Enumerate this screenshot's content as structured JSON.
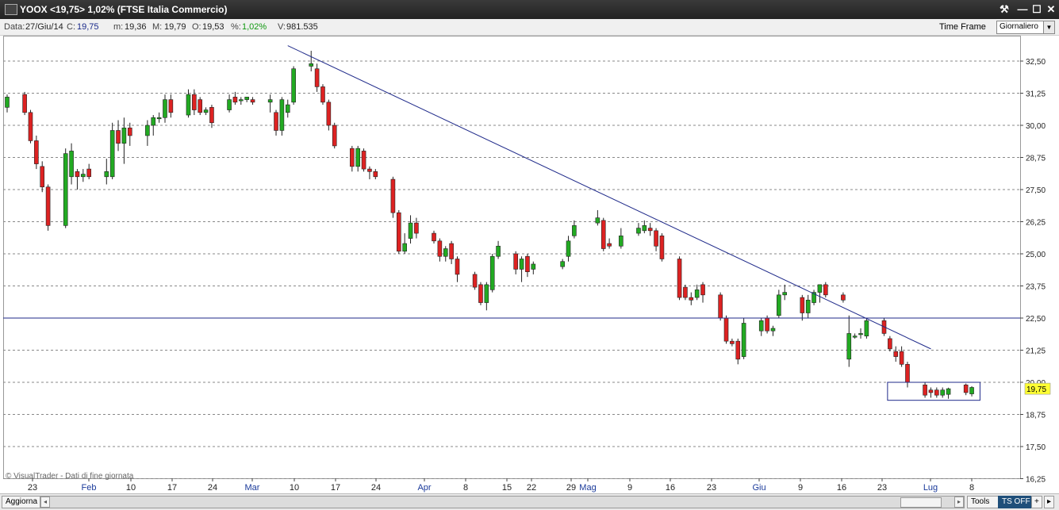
{
  "window": {
    "title": "YOOX <19,75> 1,02%  (FTSE Italia Commercio)",
    "controls": [
      "⚒",
      "—",
      "☐",
      "✕"
    ]
  },
  "infobar": {
    "data_label": "Data:",
    "data_value": "27/Giu/14",
    "c_label": "C:",
    "c_value": "19,75",
    "m_label": "m:",
    "m_value": "19,36",
    "M_label": "M:",
    "M_value": "19,79",
    "o_label": "O:",
    "o_value": "19,53",
    "pct_label": "%:",
    "pct_value": "1,02%",
    "v_label": "V:",
    "v_value": "981.535",
    "timeframe_label": "Time Frame",
    "timeframe_value": "Giornaliero"
  },
  "watermark": "© VisualTrader - Dati di fine giornata",
  "current_price_label": "19,75",
  "bottombar": {
    "refresh_label": "Aggiorna",
    "tools_label": "Tools",
    "tsoff_label": "TS OFF",
    "plus_label": "+",
    "arrow_label": "▸"
  },
  "colors": {
    "up": "#22aa22",
    "down": "#dd2222",
    "trendline": "#1f2a8a",
    "price_tag": "#ffff33",
    "grid": "#888888"
  },
  "chart_data": {
    "type": "candlestick",
    "ylim": [
      16.25,
      33.4
    ],
    "y_ticks": [
      "32,50",
      "31,25",
      "30,00",
      "28,75",
      "27,50",
      "26,25",
      "25,00",
      "23,75",
      "22,50",
      "21,25",
      "20,00",
      "18,75",
      "17,50",
      "16,25"
    ],
    "x_ticks": [
      "23",
      "Feb",
      "10",
      "17",
      "24",
      "Mar",
      "10",
      "17",
      "24",
      "Apr",
      "8",
      "15",
      "22",
      "29",
      "Mag",
      "9",
      "16",
      "23",
      "Giu",
      "9",
      "16",
      "23",
      "Lug",
      "8"
    ],
    "horizontal_line_value": 22.5,
    "trendline": {
      "from": [
        "2014-03-06",
        33.1
      ],
      "to": [
        "2014-06-24",
        21.3
      ]
    },
    "consolidation_box": {
      "from": "2014-06-17",
      "to": "2014-07-02",
      "high": 20.0,
      "low": 19.3
    },
    "candles": [
      {
        "date": "2014-01-17",
        "o": 30.7,
        "h": 31.2,
        "l": 30.5,
        "c": 31.1
      },
      {
        "date": "2014-01-20",
        "o": 31.2,
        "h": 31.3,
        "l": 30.4,
        "c": 30.5
      },
      {
        "date": "2014-01-21",
        "o": 30.5,
        "h": 30.6,
        "l": 29.3,
        "c": 29.4
      },
      {
        "date": "2014-01-22",
        "o": 29.4,
        "h": 29.6,
        "l": 28.3,
        "c": 28.5
      },
      {
        "date": "2014-01-23",
        "o": 28.4,
        "h": 28.6,
        "l": 27.4,
        "c": 27.6
      },
      {
        "date": "2014-01-24",
        "o": 27.6,
        "h": 27.7,
        "l": 25.9,
        "c": 26.1
      },
      {
        "date": "2014-01-27",
        "o": 26.1,
        "h": 29.1,
        "l": 26.0,
        "c": 28.9
      },
      {
        "date": "2014-01-28",
        "o": 28.0,
        "h": 29.3,
        "l": 27.7,
        "c": 29.0
      },
      {
        "date": "2014-01-29",
        "o": 28.2,
        "h": 28.3,
        "l": 27.5,
        "c": 28.0
      },
      {
        "date": "2014-01-30",
        "o": 28.0,
        "h": 28.3,
        "l": 27.8,
        "c": 28.1
      },
      {
        "date": "2014-01-31",
        "o": 28.3,
        "h": 28.5,
        "l": 27.9,
        "c": 28.0
      },
      {
        "date": "2014-02-03",
        "o": 28.0,
        "h": 28.7,
        "l": 27.7,
        "c": 28.2
      },
      {
        "date": "2014-02-04",
        "o": 28.0,
        "h": 30.1,
        "l": 27.9,
        "c": 29.8
      },
      {
        "date": "2014-02-05",
        "o": 29.8,
        "h": 30.2,
        "l": 29.0,
        "c": 29.3
      },
      {
        "date": "2014-02-06",
        "o": 29.3,
        "h": 30.3,
        "l": 28.5,
        "c": 29.9
      },
      {
        "date": "2014-02-07",
        "o": 29.9,
        "h": 30.1,
        "l": 29.2,
        "c": 29.6
      },
      {
        "date": "2014-02-10",
        "o": 29.6,
        "h": 30.2,
        "l": 29.2,
        "c": 30.0
      },
      {
        "date": "2014-02-11",
        "o": 30.0,
        "h": 30.4,
        "l": 29.6,
        "c": 30.3
      },
      {
        "date": "2014-02-12",
        "o": 30.3,
        "h": 30.5,
        "l": 30.1,
        "c": 30.3
      },
      {
        "date": "2014-02-13",
        "o": 30.3,
        "h": 31.2,
        "l": 30.1,
        "c": 31.0
      },
      {
        "date": "2014-02-14",
        "o": 31.0,
        "h": 31.2,
        "l": 30.3,
        "c": 30.5
      },
      {
        "date": "2014-02-17",
        "o": 30.4,
        "h": 31.4,
        "l": 30.3,
        "c": 31.2
      },
      {
        "date": "2014-02-18",
        "o": 31.2,
        "h": 31.4,
        "l": 30.4,
        "c": 30.6
      },
      {
        "date": "2014-02-19",
        "o": 31.0,
        "h": 31.1,
        "l": 30.4,
        "c": 30.5
      },
      {
        "date": "2014-02-20",
        "o": 30.5,
        "h": 30.7,
        "l": 30.4,
        "c": 30.6
      },
      {
        "date": "2014-02-21",
        "o": 30.7,
        "h": 30.8,
        "l": 29.9,
        "c": 30.1
      },
      {
        "date": "2014-02-24",
        "o": 30.6,
        "h": 31.2,
        "l": 30.5,
        "c": 31.0
      },
      {
        "date": "2014-02-25",
        "o": 31.1,
        "h": 31.3,
        "l": 30.8,
        "c": 30.9
      },
      {
        "date": "2014-02-26",
        "o": 31.0,
        "h": 31.1,
        "l": 30.8,
        "c": 31.0
      },
      {
        "date": "2014-02-27",
        "o": 31.0,
        "h": 31.1,
        "l": 30.9,
        "c": 31.1
      },
      {
        "date": "2014-02-28",
        "o": 31.0,
        "h": 31.1,
        "l": 30.8,
        "c": 30.9
      },
      {
        "date": "2014-03-03",
        "o": 30.9,
        "h": 31.2,
        "l": 30.5,
        "c": 31.0
      },
      {
        "date": "2014-03-04",
        "o": 30.5,
        "h": 30.6,
        "l": 29.6,
        "c": 29.8
      },
      {
        "date": "2014-03-05",
        "o": 29.8,
        "h": 31.1,
        "l": 29.6,
        "c": 31.0
      },
      {
        "date": "2014-03-06",
        "o": 30.5,
        "h": 31.0,
        "l": 30.3,
        "c": 30.8
      },
      {
        "date": "2014-03-07",
        "o": 30.9,
        "h": 32.3,
        "l": 30.8,
        "c": 32.2
      },
      {
        "date": "2014-03-10",
        "o": 32.3,
        "h": 32.9,
        "l": 32.1,
        "c": 32.4
      },
      {
        "date": "2014-03-11",
        "o": 32.2,
        "h": 32.4,
        "l": 31.3,
        "c": 31.5
      },
      {
        "date": "2014-03-12",
        "o": 31.5,
        "h": 31.6,
        "l": 30.8,
        "c": 30.9
      },
      {
        "date": "2014-03-13",
        "o": 30.9,
        "h": 31.0,
        "l": 29.8,
        "c": 30.0
      },
      {
        "date": "2014-03-14",
        "o": 30.0,
        "h": 30.1,
        "l": 29.1,
        "c": 29.2
      },
      {
        "date": "2014-03-17",
        "o": 29.1,
        "h": 29.2,
        "l": 28.2,
        "c": 28.4
      },
      {
        "date": "2014-03-18",
        "o": 28.4,
        "h": 29.2,
        "l": 28.2,
        "c": 29.1
      },
      {
        "date": "2014-03-19",
        "o": 29.0,
        "h": 29.1,
        "l": 28.2,
        "c": 28.3
      },
      {
        "date": "2014-03-20",
        "o": 28.3,
        "h": 28.4,
        "l": 27.9,
        "c": 28.2
      },
      {
        "date": "2014-03-21",
        "o": 28.2,
        "h": 28.3,
        "l": 27.9,
        "c": 28.0
      },
      {
        "date": "2014-03-24",
        "o": 27.9,
        "h": 28.0,
        "l": 26.4,
        "c": 26.6
      },
      {
        "date": "2014-03-25",
        "o": 26.6,
        "h": 26.7,
        "l": 25.0,
        "c": 25.1
      },
      {
        "date": "2014-03-26",
        "o": 25.1,
        "h": 25.8,
        "l": 25.0,
        "c": 25.4
      },
      {
        "date": "2014-03-27",
        "o": 25.6,
        "h": 26.5,
        "l": 25.4,
        "c": 26.2
      },
      {
        "date": "2014-03-28",
        "o": 26.2,
        "h": 26.4,
        "l": 25.6,
        "c": 25.8
      },
      {
        "date": "2014-03-31",
        "o": 25.8,
        "h": 25.9,
        "l": 25.4,
        "c": 25.5
      },
      {
        "date": "2014-04-01",
        "o": 25.5,
        "h": 25.6,
        "l": 24.7,
        "c": 24.9
      },
      {
        "date": "2014-04-02",
        "o": 24.9,
        "h": 25.3,
        "l": 24.7,
        "c": 25.2
      },
      {
        "date": "2014-04-03",
        "o": 25.4,
        "h": 25.5,
        "l": 24.6,
        "c": 24.8
      },
      {
        "date": "2014-04-04",
        "o": 24.8,
        "h": 24.9,
        "l": 23.9,
        "c": 24.2
      },
      {
        "date": "2014-04-07",
        "o": 24.2,
        "h": 24.3,
        "l": 23.6,
        "c": 23.7
      },
      {
        "date": "2014-04-08",
        "o": 23.8,
        "h": 23.9,
        "l": 23.0,
        "c": 23.1
      },
      {
        "date": "2014-04-09",
        "o": 23.1,
        "h": 23.9,
        "l": 22.8,
        "c": 23.8
      },
      {
        "date": "2014-04-10",
        "o": 23.6,
        "h": 25.0,
        "l": 23.5,
        "c": 24.9
      },
      {
        "date": "2014-04-11",
        "o": 24.9,
        "h": 25.5,
        "l": 24.8,
        "c": 25.3
      },
      {
        "date": "2014-04-14",
        "o": 25.0,
        "h": 25.1,
        "l": 24.2,
        "c": 24.4
      },
      {
        "date": "2014-04-15",
        "o": 24.4,
        "h": 24.9,
        "l": 23.9,
        "c": 24.8
      },
      {
        "date": "2014-04-16",
        "o": 24.9,
        "h": 25.0,
        "l": 24.1,
        "c": 24.3
      },
      {
        "date": "2014-04-17",
        "o": 24.4,
        "h": 24.7,
        "l": 24.2,
        "c": 24.6
      },
      {
        "date": "2014-04-22",
        "o": 24.5,
        "h": 24.8,
        "l": 24.4,
        "c": 24.7
      },
      {
        "date": "2014-04-23",
        "o": 24.9,
        "h": 25.7,
        "l": 24.7,
        "c": 25.5
      },
      {
        "date": "2014-04-24",
        "o": 25.7,
        "h": 26.3,
        "l": 25.6,
        "c": 26.1
      },
      {
        "date": "2014-04-28",
        "o": 26.2,
        "h": 26.7,
        "l": 26.1,
        "c": 26.4
      },
      {
        "date": "2014-04-29",
        "o": 26.3,
        "h": 26.4,
        "l": 25.1,
        "c": 25.2
      },
      {
        "date": "2014-04-30",
        "o": 25.4,
        "h": 25.6,
        "l": 25.2,
        "c": 25.3
      },
      {
        "date": "2014-05-02",
        "o": 25.3,
        "h": 26.0,
        "l": 25.2,
        "c": 25.7
      },
      {
        "date": "2014-05-05",
        "o": 25.8,
        "h": 26.2,
        "l": 25.7,
        "c": 26.0
      },
      {
        "date": "2014-05-06",
        "o": 25.9,
        "h": 26.3,
        "l": 25.8,
        "c": 26.1
      },
      {
        "date": "2014-05-07",
        "o": 26.0,
        "h": 26.2,
        "l": 25.7,
        "c": 25.9
      },
      {
        "date": "2014-05-08",
        "o": 25.9,
        "h": 26.0,
        "l": 25.1,
        "c": 25.3
      },
      {
        "date": "2014-05-09",
        "o": 25.7,
        "h": 25.8,
        "l": 24.7,
        "c": 24.8
      },
      {
        "date": "2014-05-12",
        "o": 24.8,
        "h": 24.9,
        "l": 23.2,
        "c": 23.3
      },
      {
        "date": "2014-05-13",
        "o": 23.7,
        "h": 23.8,
        "l": 23.2,
        "c": 23.3
      },
      {
        "date": "2014-05-14",
        "o": 23.3,
        "h": 23.5,
        "l": 23.0,
        "c": 23.2
      },
      {
        "date": "2014-05-15",
        "o": 23.3,
        "h": 23.8,
        "l": 23.2,
        "c": 23.6
      },
      {
        "date": "2014-05-16",
        "o": 23.8,
        "h": 23.9,
        "l": 23.1,
        "c": 23.4
      },
      {
        "date": "2014-05-19",
        "o": 23.4,
        "h": 23.5,
        "l": 22.4,
        "c": 22.5
      },
      {
        "date": "2014-05-20",
        "o": 22.5,
        "h": 22.6,
        "l": 21.5,
        "c": 21.6
      },
      {
        "date": "2014-05-21",
        "o": 21.6,
        "h": 21.7,
        "l": 21.4,
        "c": 21.5
      },
      {
        "date": "2014-05-22",
        "o": 21.6,
        "h": 21.7,
        "l": 20.7,
        "c": 20.9
      },
      {
        "date": "2014-05-23",
        "o": 21.0,
        "h": 22.5,
        "l": 20.9,
        "c": 22.3
      },
      {
        "date": "2014-05-26",
        "o": 22.0,
        "h": 22.5,
        "l": 21.8,
        "c": 22.4
      },
      {
        "date": "2014-05-27",
        "o": 22.5,
        "h": 22.6,
        "l": 21.9,
        "c": 22.0
      },
      {
        "date": "2014-05-28",
        "o": 22.0,
        "h": 22.2,
        "l": 21.8,
        "c": 22.1
      },
      {
        "date": "2014-05-29",
        "o": 22.6,
        "h": 23.6,
        "l": 22.5,
        "c": 23.4
      },
      {
        "date": "2014-05-30",
        "o": 23.4,
        "h": 23.8,
        "l": 23.2,
        "c": 23.5
      },
      {
        "date": "2014-06-02",
        "o": 23.3,
        "h": 23.4,
        "l": 22.4,
        "c": 22.7
      },
      {
        "date": "2014-06-03",
        "o": 22.7,
        "h": 23.4,
        "l": 22.5,
        "c": 23.2
      },
      {
        "date": "2014-06-04",
        "o": 23.1,
        "h": 23.6,
        "l": 23.0,
        "c": 23.5
      },
      {
        "date": "2014-06-05",
        "o": 23.5,
        "h": 23.8,
        "l": 23.1,
        "c": 23.8
      },
      {
        "date": "2014-06-06",
        "o": 23.8,
        "h": 23.9,
        "l": 23.3,
        "c": 23.4
      },
      {
        "date": "2014-06-09",
        "o": 23.4,
        "h": 23.5,
        "l": 23.1,
        "c": 23.2
      },
      {
        "date": "2014-06-10",
        "o": 20.9,
        "h": 22.6,
        "l": 20.6,
        "c": 21.9
      },
      {
        "date": "2014-06-11",
        "o": 21.8,
        "h": 21.9,
        "l": 21.7,
        "c": 21.8
      },
      {
        "date": "2014-06-12",
        "o": 21.9,
        "h": 22.1,
        "l": 21.7,
        "c": 21.9
      },
      {
        "date": "2014-06-13",
        "o": 21.8,
        "h": 22.5,
        "l": 21.7,
        "c": 22.4
      },
      {
        "date": "2014-06-16",
        "o": 22.4,
        "h": 22.5,
        "l": 21.8,
        "c": 21.9
      },
      {
        "date": "2014-06-17",
        "o": 21.7,
        "h": 21.8,
        "l": 21.2,
        "c": 21.3
      },
      {
        "date": "2014-06-18",
        "o": 21.2,
        "h": 21.4,
        "l": 20.8,
        "c": 21.0
      },
      {
        "date": "2014-06-19",
        "o": 21.2,
        "h": 21.4,
        "l": 20.6,
        "c": 20.7
      },
      {
        "date": "2014-06-20",
        "o": 20.7,
        "h": 20.8,
        "l": 19.8,
        "c": 20.0
      },
      {
        "date": "2014-06-23",
        "o": 19.9,
        "h": 20.0,
        "l": 19.4,
        "c": 19.5
      },
      {
        "date": "2014-06-24",
        "o": 19.7,
        "h": 19.8,
        "l": 19.4,
        "c": 19.6
      },
      {
        "date": "2014-06-25",
        "o": 19.7,
        "h": 19.8,
        "l": 19.4,
        "c": 19.5
      },
      {
        "date": "2014-06-26",
        "o": 19.5,
        "h": 19.8,
        "l": 19.4,
        "c": 19.7
      },
      {
        "date": "2014-06-27",
        "o": 19.53,
        "h": 19.79,
        "l": 19.36,
        "c": 19.75
      },
      {
        "date": "2014-06-30",
        "o": 19.9,
        "h": 19.95,
        "l": 19.5,
        "c": 19.6
      },
      {
        "date": "2014-07-01",
        "o": 19.55,
        "h": 19.85,
        "l": 19.45,
        "c": 19.8
      }
    ]
  }
}
